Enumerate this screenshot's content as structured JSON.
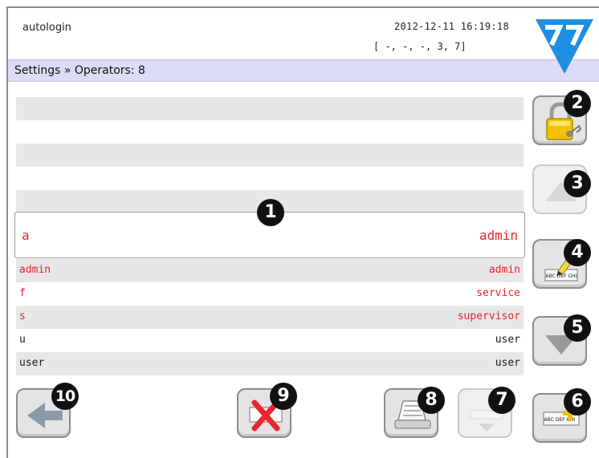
{
  "header": {
    "app_name": "autologin",
    "datetime": "2012-12-11 16:19:18",
    "coords": "[ -, -, -, 3, 7]"
  },
  "breadcrumb": "Settings » Operators: 8",
  "selected_operator": {
    "login": "a",
    "role": "admin"
  },
  "operators": [
    {
      "login": "admin",
      "role": "admin",
      "color": "#e8262c"
    },
    {
      "login": "f",
      "role": "service",
      "color": "#e8262c"
    },
    {
      "login": "s",
      "role": "supervisor",
      "color": "#e8262c"
    },
    {
      "login": "u",
      "role": "user",
      "color": "#1a1a1a"
    },
    {
      "login": "user",
      "role": "user",
      "color": "#1a1a1a"
    }
  ],
  "icons": {
    "logo": "77-triangle-logo",
    "lock": "padlock-icon",
    "up": "arrow-up-icon",
    "edit": "pencil-edit-icon",
    "down": "arrow-down-icon",
    "add": "add-text-icon",
    "scroll": "up-down-scroll-icon",
    "print": "print-icon",
    "delete": "delete-icon",
    "back": "back-arrow-icon"
  },
  "button_labels": {
    "edit_text": "ABC DEF GHI",
    "add_text": "ABC DEF GHI"
  },
  "callouts": [
    "1",
    "2",
    "3",
    "4",
    "5",
    "6",
    "7",
    "8",
    "9",
    "10"
  ],
  "colors": {
    "accent": "#1e8fe0",
    "selected_text": "#e8262c",
    "breadcrumb_bg": "#dcdcf8"
  }
}
